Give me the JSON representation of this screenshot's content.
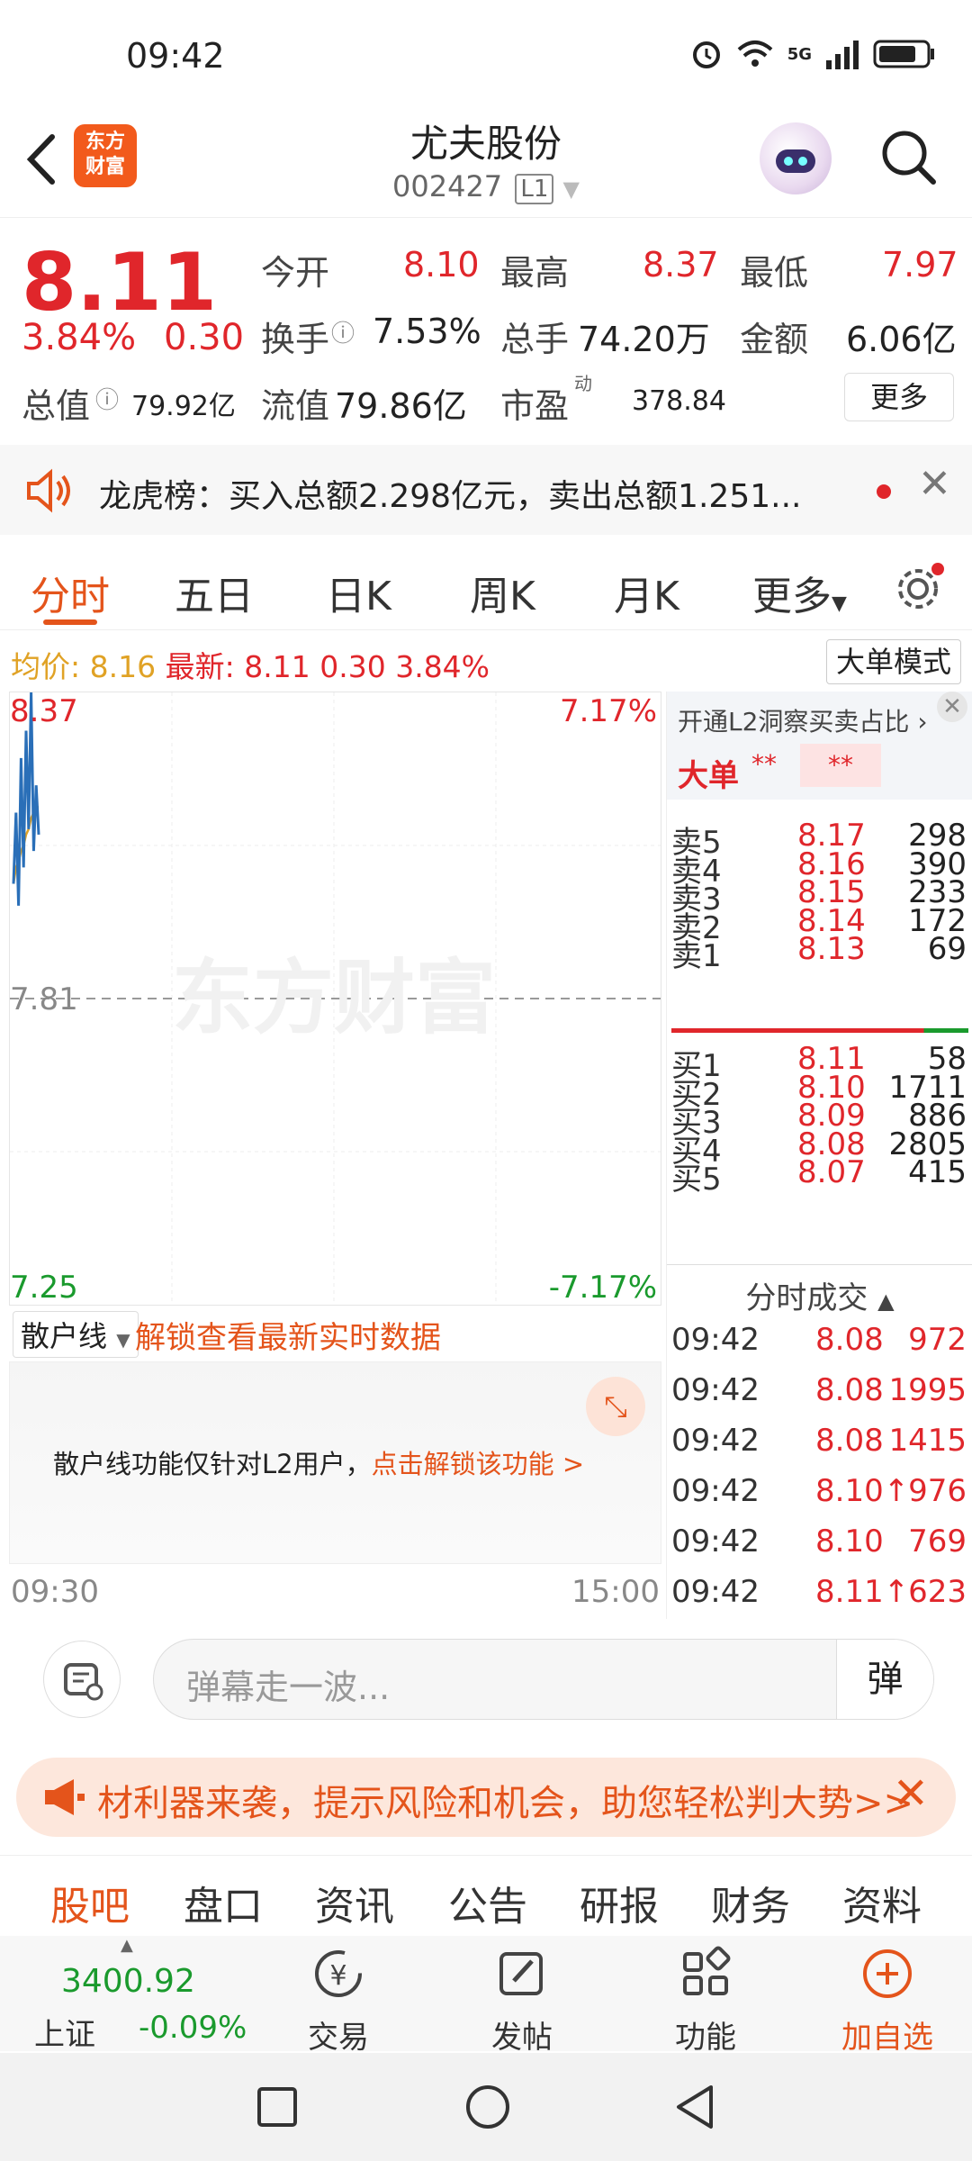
{
  "status": {
    "time": "09:42",
    "network": "5G"
  },
  "header": {
    "logo_line1": "东方",
    "logo_line2": "财富",
    "stock_name": "尤夫股份",
    "stock_code": "002427",
    "level": "L1"
  },
  "quote": {
    "price": "8.11",
    "pct": "3.84%",
    "change": "0.30",
    "open_label": "今开",
    "open": "8.10",
    "high_label": "最高",
    "high": "8.37",
    "low_label": "最低",
    "low": "7.97",
    "turnover_label": "换手",
    "turnover": "7.53%",
    "volume_label": "总手",
    "volume": "74.20万",
    "amount_label": "金额",
    "amount": "6.06亿",
    "total_value_label": "总值",
    "total_value": "79.92亿",
    "float_value_label": "流值",
    "float_value": "79.86亿",
    "pe_label": "市盈",
    "pe_sup": "动",
    "pe": "378.84",
    "more_label": "更多"
  },
  "notice": {
    "text": "龙虎榜：买入总额2.298亿元，卖出总额1.251..."
  },
  "tabs": [
    "分时",
    "五日",
    "日K",
    "周K",
    "月K",
    "更多"
  ],
  "infoline": {
    "avg_label": "均价:",
    "avg": "8.16",
    "latest_label": "最新:",
    "latest": "8.11",
    "change": "0.30",
    "pct": "3.84%",
    "bigorder_label": "大单模式"
  },
  "chart_data": {
    "type": "line",
    "y_max_label": "8.37",
    "y_mid_label": "7.81",
    "y_min_label": "7.25",
    "pct_max_label": "7.17%",
    "pct_min_label": "-7.17%",
    "ylim": [
      7.25,
      8.37
    ],
    "prev_close": 7.81,
    "x_start_label": "09:30",
    "x_end_label": "15:00",
    "watermark": "东方财富",
    "series": [
      {
        "values": [
          8.02,
          8.15,
          7.98,
          8.25,
          8.05,
          8.3,
          8.12,
          8.37,
          8.08,
          8.2,
          8.11
        ]
      },
      {
        "values": [
          8.02,
          8.05,
          8.06,
          8.08,
          8.09,
          8.11,
          8.12,
          8.14,
          8.15,
          8.16,
          8.16
        ]
      }
    ]
  },
  "orderbook": {
    "promo": "开通L2洞察买卖占比 ›",
    "big_label": "大单",
    "masked1": "**",
    "masked2": "**",
    "sells": [
      {
        "label": "卖5",
        "price": "8.17",
        "vol": "298"
      },
      {
        "label": "卖4",
        "price": "8.16",
        "vol": "390"
      },
      {
        "label": "卖3",
        "price": "8.15",
        "vol": "233"
      },
      {
        "label": "卖2",
        "price": "8.14",
        "vol": "172"
      },
      {
        "label": "卖1",
        "price": "8.13",
        "vol": "69"
      }
    ],
    "buys": [
      {
        "label": "买1",
        "price": "8.11",
        "vol": "58"
      },
      {
        "label": "买2",
        "price": "8.10",
        "vol": "1711"
      },
      {
        "label": "买3",
        "price": "8.09",
        "vol": "886"
      },
      {
        "label": "买4",
        "price": "8.08",
        "vol": "2805"
      },
      {
        "label": "买5",
        "price": "8.07",
        "vol": "415"
      }
    ],
    "trades_title": "分时成交",
    "trades": [
      {
        "time": "09:42",
        "price": "8.08",
        "vol": "972"
      },
      {
        "time": "09:42",
        "price": "8.08",
        "vol": "1995"
      },
      {
        "time": "09:42",
        "price": "8.08",
        "vol": "1415"
      },
      {
        "time": "09:42",
        "price": "8.10↑",
        "vol": "976"
      },
      {
        "time": "09:42",
        "price": "8.10",
        "vol": "769"
      },
      {
        "time": "09:42",
        "price": "8.11↑",
        "vol": "623"
      }
    ]
  },
  "retail": {
    "select_label": "散户线",
    "unlock_text": "解锁查看最新实时数据",
    "panel_text": "散户线功能仅针对L2用户，",
    "panel_link": "点击解锁该功能 >"
  },
  "danmaku": {
    "placeholder": "弹幕走一波...",
    "send": "弹"
  },
  "promo": {
    "text": "材利器来袭，提示风险和机会，助您轻松判大势>>"
  },
  "bottom_tabs": [
    "股吧",
    "盘口",
    "资讯",
    "公告",
    "研报",
    "财务",
    "资料"
  ],
  "bottom_nav": {
    "index_value": "3400.92",
    "index_name": "上证",
    "index_change": "-0.09%",
    "trade": "交易",
    "post": "发帖",
    "func": "功能",
    "add": "加自选"
  },
  "colors": {
    "up": "#e0262b",
    "down": "#1a9a2d",
    "accent": "#e4541b"
  }
}
